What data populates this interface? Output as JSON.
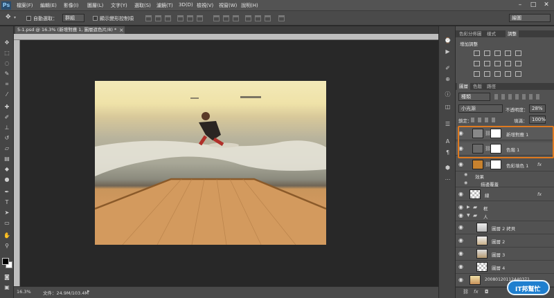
{
  "menubar": {
    "logo": "Ps",
    "items": [
      "檔案(F)",
      "編輯(E)",
      "影像(I)",
      "圖層(L)",
      "文字(Y)",
      "選取(S)",
      "濾鏡(T)",
      "3D(D)",
      "檢視(V)",
      "視窗(W)",
      "說明(H)"
    ],
    "window_buttons": [
      "–",
      "□",
      "✕"
    ]
  },
  "options": {
    "auto_select_label": "自動選取：",
    "auto_select_value": "群組",
    "transform_label": "顯示變形控制項",
    "workspace": "繪圖"
  },
  "document": {
    "tab_label": "5-1.psd @ 16.3% (新增對應 1, 圖層遮色片/8) *",
    "close_icon": "×"
  },
  "status": {
    "zoom": "16.3%",
    "file_info": "文件：24.9M/103.4M"
  },
  "panels": {
    "top_tabs": [
      "色彩分佈圖",
      "樣式",
      "調整"
    ],
    "adjust_title": "增加調整",
    "layers_tabs": [
      "圖層",
      "色版",
      "路徑"
    ],
    "kind_filter": "種類",
    "blend_mode": "小光源",
    "opacity_label": "不透明度：",
    "opacity_value": "28%",
    "lock_label": "鎖定：",
    "fill_label": "填滿：",
    "fill_value": "100%"
  },
  "layers": [
    {
      "name": "新增對應 1",
      "fx": ""
    },
    {
      "name": "色階 1",
      "fx": ""
    },
    {
      "name": "色彩填色 1",
      "fx": "fx"
    },
    {
      "name": "效果",
      "fx": ""
    },
    {
      "name": "描邊覆蓋",
      "fx": ""
    },
    {
      "name": "線",
      "fx": "fx"
    },
    {
      "name": "框",
      "fx": ""
    },
    {
      "name": "人",
      "fx": ""
    },
    {
      "name": "圖層 2 拷貝",
      "fx": ""
    },
    {
      "name": "圖層 2",
      "fx": ""
    },
    {
      "name": "圖層 3",
      "fx": ""
    },
    {
      "name": "圖層 4",
      "fx": ""
    },
    {
      "name": "20080120112440371",
      "fx": ""
    }
  ],
  "colors": {
    "highlight": "#e07a1f",
    "foreground_swatch": "#000000",
    "background_swatch": "#ffffff",
    "fill_layer_color": "#c8822e"
  },
  "watermark": "IT邦幫忙"
}
